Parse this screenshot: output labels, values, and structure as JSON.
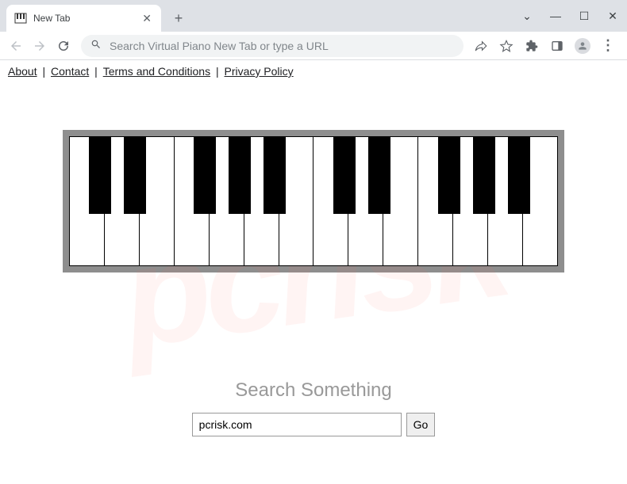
{
  "window": {
    "tab_title": "New Tab",
    "omnibox_placeholder": "Search Virtual Piano New Tab or type a URL"
  },
  "top_links": {
    "about": "About",
    "contact": "Contact",
    "terms": "Terms and Conditions",
    "privacy": "Privacy Policy",
    "separator": " | "
  },
  "search": {
    "heading": "Search Something",
    "input_value": "pcrisk.com",
    "button_label": "Go"
  },
  "watermark": "pcrisk",
  "piano": {
    "white_key_count": 14,
    "black_key_positions_pct": [
      4.1,
      11.2,
      25.5,
      32.6,
      39.8,
      54.1,
      61.2,
      75.5,
      82.6,
      89.8
    ]
  },
  "icons": {
    "back": "←",
    "forward": "→",
    "reload": "⟳",
    "search": "🔍",
    "share": "↗",
    "star": "☆",
    "extensions": "✦",
    "panel": "▣",
    "menu": "⋮",
    "close": "✕",
    "plus": "+",
    "minimize": "—",
    "maximize": "☐",
    "window_close": "✕",
    "chevron": "⌄"
  }
}
